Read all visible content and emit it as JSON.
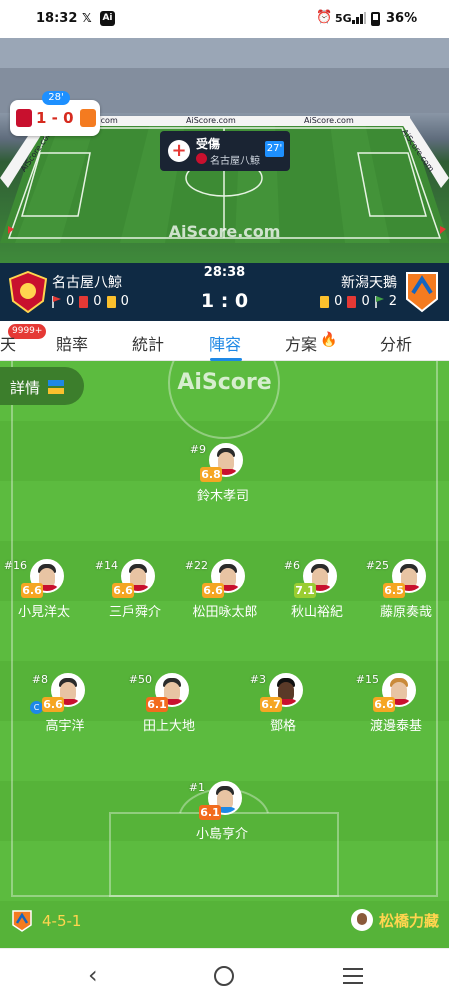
{
  "status_bar": {
    "time": "18:32",
    "network": "5G",
    "battery": "36%"
  },
  "animation": {
    "minute_badge": "28'",
    "score_chip": "1 - 0",
    "watermark": "AiScore.com",
    "ad_boards": [
      "AiScore.com",
      "AiScore.com",
      "AiScore.com",
      "AiScore.com",
      "AiScore.com"
    ],
    "event": {
      "title": "受傷",
      "team": "名古屋八鯨",
      "minute": "27'"
    }
  },
  "match": {
    "time": "28:38",
    "score": "1 : 0",
    "home": {
      "name": "名古屋八鯨",
      "corners": "0",
      "red": "0",
      "yellow": "0",
      "crest_color": "#c8102e"
    },
    "away": {
      "name": "新潟天鵝",
      "yellow": "0",
      "red": "0",
      "corners": "2",
      "crest_color": "#f47b20"
    }
  },
  "tabs": {
    "items": [
      "天",
      "賠率",
      "統計",
      "陣容",
      "方案",
      "分析"
    ],
    "active": "陣容",
    "badge": "9999+"
  },
  "lineup": {
    "details_label": "詳情",
    "watermark": "AiScore",
    "players": [
      {
        "number": "#9",
        "name": "鈴木孝司",
        "rating": "6.8",
        "rating_color": "#f5a623"
      },
      {
        "number": "#16",
        "name": "小見洋太",
        "rating": "6.6",
        "rating_color": "#f5a623"
      },
      {
        "number": "#14",
        "name": "三戶舜介",
        "rating": "6.6",
        "rating_color": "#f5a623"
      },
      {
        "number": "#22",
        "name": "松田咏太郎",
        "rating": "6.6",
        "rating_color": "#f5a623"
      },
      {
        "number": "#6",
        "name": "秋山裕紀",
        "rating": "7.1",
        "rating_color": "#9acd32"
      },
      {
        "number": "#25",
        "name": "藤原奏哉",
        "rating": "6.5",
        "rating_color": "#f5a623"
      },
      {
        "number": "#8",
        "name": "高宇洋",
        "rating": "6.6",
        "rating_color": "#f5a623",
        "captain": "C"
      },
      {
        "number": "#50",
        "name": "田上大地",
        "rating": "6.1",
        "rating_color": "#f26b1d"
      },
      {
        "number": "#3",
        "name": "鄧格",
        "rating": "6.7",
        "rating_color": "#f5a623"
      },
      {
        "number": "#15",
        "name": "渡邊泰基",
        "rating": "6.6",
        "rating_color": "#f5a623"
      },
      {
        "number": "#1",
        "name": "小島亨介",
        "rating": "6.1",
        "rating_color": "#f26b1d"
      }
    ],
    "formation": "4-5-1",
    "coach": "松橋力藏"
  }
}
